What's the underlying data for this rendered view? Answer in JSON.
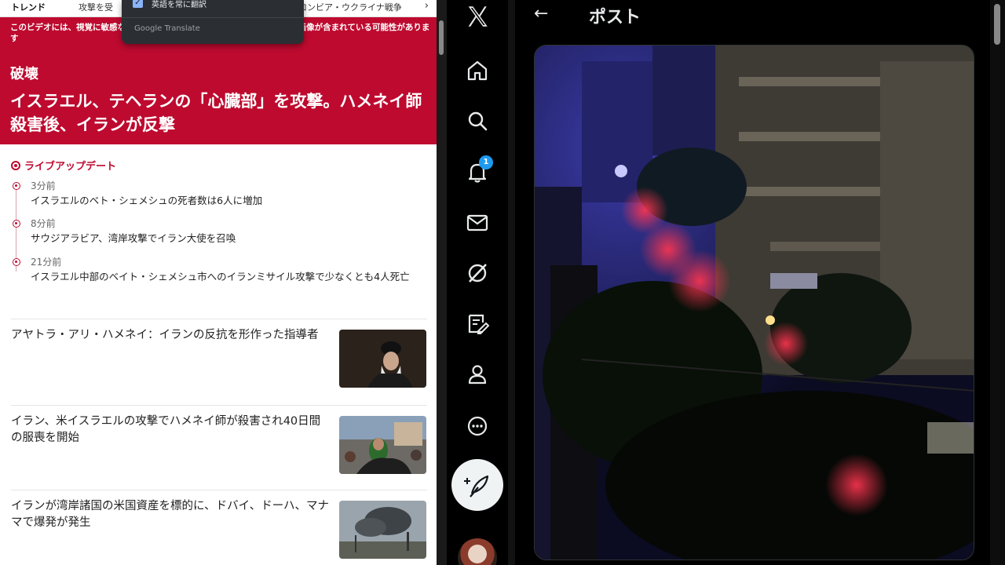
{
  "news": {
    "top_strip": {
      "trend": "トレンド",
      "item1": "攻撃を受",
      "item2": "ロンビア・ウクライナ戦争",
      "chevron": "›"
    },
    "warning": "このビデオには、視覚に敏感な方に影響を与える可能性のある光のパターンや画像が含まれている可能性があります",
    "category": "破壊",
    "headline": "イスラエル、テヘランの「心臓部」を攻撃。ハメネイ師殺害後、イランが反撃",
    "live_label": "ライブアップデート",
    "updates": [
      {
        "time": "3分前",
        "text": "イスラエルのベト・シェメシュの死者数は6人に増加"
      },
      {
        "time": "8分前",
        "text": "サウジアラビア、湾岸攻撃でイラン大使を召喚"
      },
      {
        "time": "21分前",
        "text": "イスラエル中部のベイト・シェメシュ市へのイランミサイル攻撃で少なくとも4人死亡"
      }
    ],
    "articles": [
      {
        "title": "アヤトラ・アリ・ハメネイ：イランの反抗を形作った指導者"
      },
      {
        "title": "イラン、米イスラエルの攻撃でハメネイ師が殺害され40日間の服喪を開始"
      },
      {
        "title": "イランが湾岸諸国の米国資産を標的に、ドバイ、ドーハ、マナマで爆発が発生"
      }
    ]
  },
  "translate_popup": {
    "option": "英語を常に翻訳",
    "brand": "Google Translate"
  },
  "x": {
    "logo": "𝕏",
    "notification_count": "1",
    "post_title": "ポスト",
    "back_arrow": "←",
    "nav_icons": [
      "home-icon",
      "search-icon",
      "notifications-icon",
      "messages-icon",
      "grok-icon",
      "articles-icon",
      "profile-icon",
      "more-icon"
    ]
  },
  "colors": {
    "news_red": "#be0a2f",
    "x_blue": "#1d9bf0",
    "x_text": "#e7e9ea"
  }
}
